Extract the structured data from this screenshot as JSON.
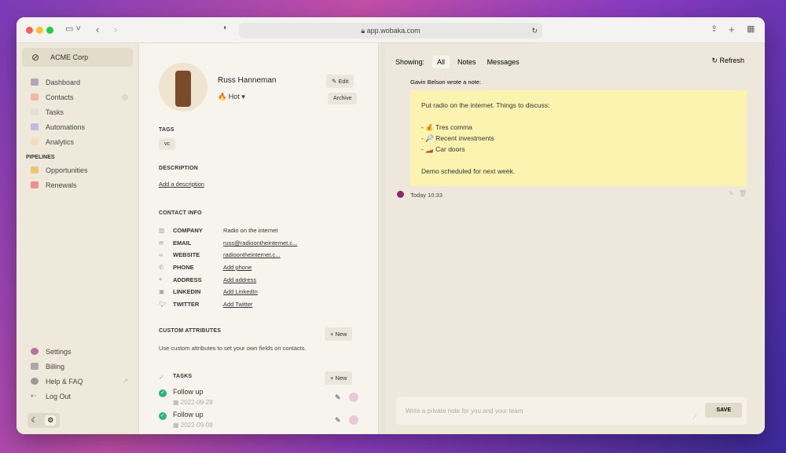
{
  "browser": {
    "url": "app.wobaka.com"
  },
  "sidebar": {
    "org": "ACME Corp",
    "items": [
      {
        "label": "Dashboard"
      },
      {
        "label": "Contacts"
      },
      {
        "label": "Tasks"
      },
      {
        "label": "Automations"
      },
      {
        "label": "Analytics"
      }
    ],
    "pipelines_heading": "PIPELINES",
    "pipelines": [
      {
        "label": "Opportunities"
      },
      {
        "label": "Renewals"
      }
    ],
    "bottom": [
      {
        "label": "Settings"
      },
      {
        "label": "Billing"
      },
      {
        "label": "Help & FAQ"
      },
      {
        "label": "Log Out"
      }
    ]
  },
  "contact": {
    "name": "Russ Hanneman",
    "status": "Hot",
    "edit": "Edit",
    "archive": "Archive",
    "tags_heading": "TAGS",
    "tags": [
      "vc"
    ],
    "description_heading": "DESCRIPTION",
    "add_description": "Add a description",
    "contact_heading": "CONTACT INFO",
    "fields": [
      {
        "label": "COMPANY",
        "value": "Radio on the internet"
      },
      {
        "label": "EMAIL",
        "value": "russ@radioontheinternet.c..."
      },
      {
        "label": "WEBSITE",
        "value": "radioontheinternet.c..."
      },
      {
        "label": "PHONE",
        "value": "Add phone"
      },
      {
        "label": "ADDRESS",
        "value": "Add address"
      },
      {
        "label": "LINKEDIN",
        "value": "Add LinkedIn"
      },
      {
        "label": "TWITTER",
        "value": "Add Twitter"
      }
    ],
    "custom_heading": "CUSTOM ATTRIBUTES",
    "custom_text": "Use custom attributes to set your own fields on contacts.",
    "new": "New",
    "tasks_heading": "TASKS",
    "tasks": [
      {
        "title": "Follow up",
        "date": "2022-09-28"
      },
      {
        "title": "Follow up",
        "date": "2022-09-09"
      }
    ]
  },
  "activity": {
    "showing": "Showing:",
    "filters": [
      "All",
      "Notes",
      "Messages"
    ],
    "refresh": "Refresh",
    "author_line": "Gavin Belson wrote a note:",
    "note_lines": [
      "Put radio on the internet. Things to discuss:",
      "",
      "- 💰 Tres comma",
      "- 🔎 Recent investments",
      "- 🏎️ Car doors",
      "",
      "Demo scheduled for next week."
    ],
    "timestamp": "Today 10:33",
    "input_placeholder": "Write a private note for you and your team",
    "save": "SAVE"
  }
}
